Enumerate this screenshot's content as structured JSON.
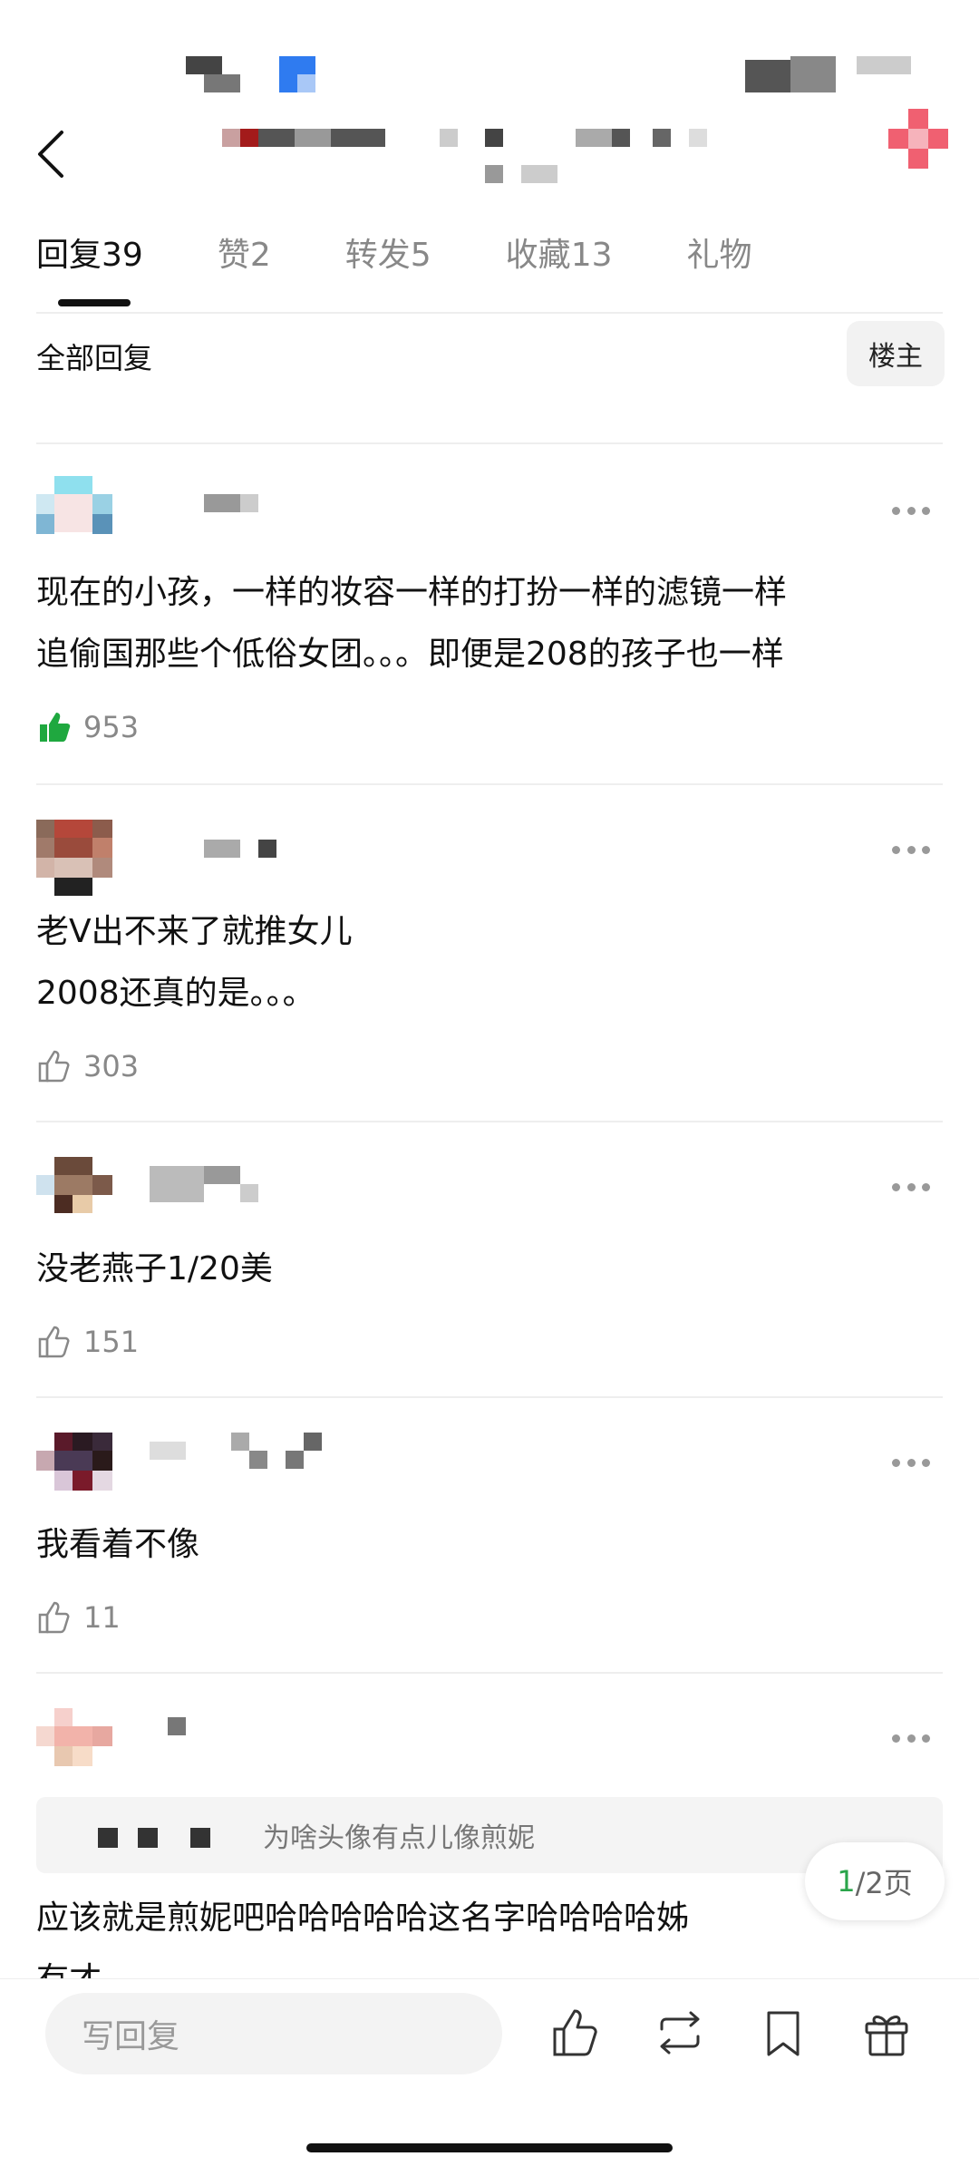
{
  "tabs": [
    {
      "label": "回复",
      "count": "39",
      "active": true
    },
    {
      "label": "赞",
      "count": "2",
      "active": false
    },
    {
      "label": "转发",
      "count": "5",
      "active": false
    },
    {
      "label": "收藏",
      "count": "13",
      "active": false
    },
    {
      "label": "礼物",
      "count": "",
      "active": false
    }
  ],
  "filter": {
    "label": "全部回复",
    "owner_button": "楼主"
  },
  "comments": [
    {
      "text_lines": [
        "现在的小孩，一样的妆容一样的打扮一样的滤镜一样",
        "追偷国那些个低俗女团。。。即便是208的孩子也一样"
      ],
      "likes": "953",
      "liked": true
    },
    {
      "text_lines": [
        "老V出不来了就推女儿",
        "2008还真的是。。。"
      ],
      "likes": "303",
      "liked": false
    },
    {
      "text_lines": [
        "没老燕子1/20美"
      ],
      "likes": "151",
      "liked": false
    },
    {
      "text_lines": [
        "我看着不像"
      ],
      "likes": "11",
      "liked": false
    },
    {
      "quote": "为啥头像有点儿像煎妮",
      "text_lines": [
        "应该就是煎妮吧哈哈哈哈哈这名字哈哈哈哈姊",
        "有才"
      ]
    }
  ],
  "pagination": {
    "current": "1",
    "total_label": "/2页"
  },
  "bottom": {
    "reply_placeholder": "写回复"
  },
  "colors": {
    "accent_green": "#2aa54b",
    "like_green": "#1fa83f",
    "text": "#111111",
    "muted": "#888888"
  },
  "icons": [
    "back-icon",
    "more-icon",
    "thumbs-up-icon",
    "repost-icon",
    "bookmark-icon",
    "gift-icon"
  ]
}
